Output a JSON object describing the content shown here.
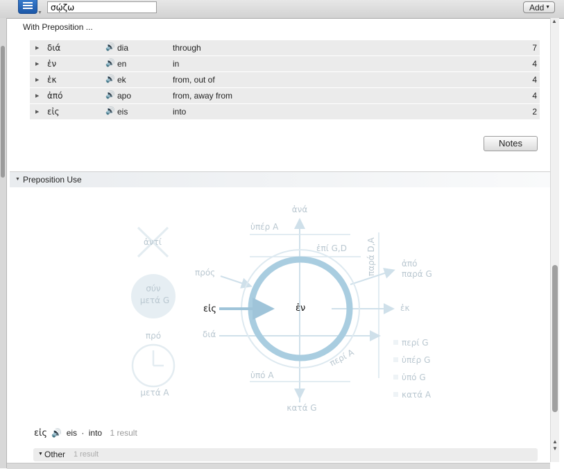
{
  "toolbar": {
    "search_value": "σῴζω",
    "add_label": "Add",
    "menu_icon": "menu-icon"
  },
  "with_preposition": {
    "heading": "With Preposition ...",
    "rows": [
      {
        "greek": "διά",
        "translit": "dia",
        "gloss": "through",
        "count": "7"
      },
      {
        "greek": "ἐν",
        "translit": "en",
        "gloss": "in",
        "count": "4"
      },
      {
        "greek": "ἐκ",
        "translit": "ek",
        "gloss": "from, out of",
        "count": "4"
      },
      {
        "greek": "ἀπό",
        "translit": "apo",
        "gloss": "from, away from",
        "count": "4"
      },
      {
        "greek": "εἰς",
        "translit": "eis",
        "gloss": "into",
        "count": "2"
      }
    ],
    "notes_label": "Notes"
  },
  "preposition_use": {
    "title": "Preposition Use",
    "labels": {
      "ana": "ἀνά",
      "hyper_a": "ὑπέρ A",
      "epi": "ἐπί G,D",
      "para_da": "παρά D,A",
      "apo": "ἀπό",
      "para_g": "παρά G",
      "pros": "πρός",
      "anti": "ἀντί",
      "syn": "σύν",
      "meta_g": "μετά G",
      "eis": "εἰς",
      "en": "ἐν",
      "ek": "ἐκ",
      "pro": "πρό",
      "dia": "διά",
      "meta_a": "μετά A",
      "hypo_a": "ὑπό A",
      "peri_a": "περί A",
      "kata_g": "κατά G",
      "peri_g": "περί G",
      "hyper_g": "ὑπέρ G",
      "hypo_g": "ὑπό G",
      "kata_a": "κατά A"
    },
    "colors": {
      "highlight_circle": "#a9cde0",
      "faint": "#cfe0ea",
      "faint_text": "#b9c7d0"
    }
  },
  "result": {
    "greek": "εἰς",
    "translit": "eis",
    "separator": "·",
    "gloss": "into",
    "count_text": "1 result"
  },
  "other": {
    "label": "Other",
    "count_text": "1 result"
  }
}
